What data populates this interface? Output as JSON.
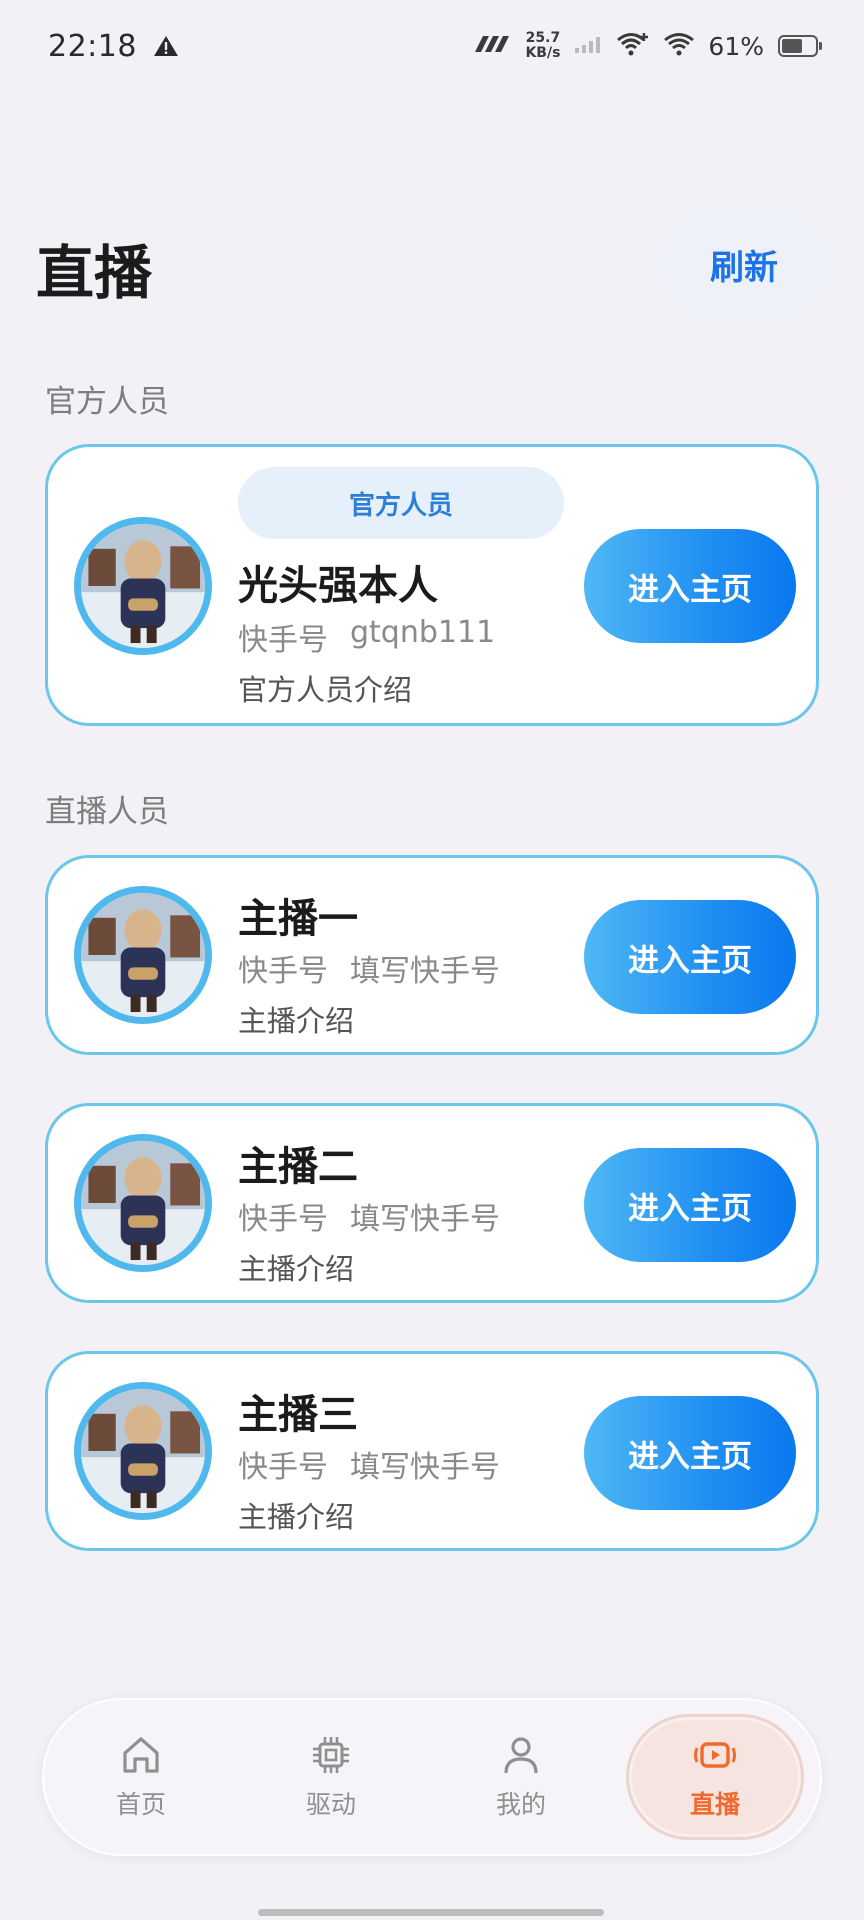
{
  "status_bar": {
    "time": "22:18",
    "net_speed_value": "25.7",
    "net_speed_unit": "KB/s",
    "battery_percent": "61%",
    "battery_level": 0.61,
    "icons": [
      "warning-icon",
      "hyperos-logo-icon",
      "signal-icon",
      "wifi-plus-icon",
      "wifi-icon",
      "battery-icon"
    ]
  },
  "header": {
    "title": "直播",
    "refresh_label": "刷新"
  },
  "official_section": {
    "label": "官方人员",
    "card": {
      "badge": "官方人员",
      "name": "光头强本人",
      "kuaishou_label": "快手号",
      "kuaishou_value": "gtqnb111",
      "intro": "官方人员介绍",
      "button_label": "进入主页"
    }
  },
  "streamer_section": {
    "label": "直播人员",
    "cards": [
      {
        "name": "主播一",
        "kuaishou_label": "快手号",
        "kuaishou_value": "填写快手号",
        "intro": "主播介绍",
        "button_label": "进入主页"
      },
      {
        "name": "主播二",
        "kuaishou_label": "快手号",
        "kuaishou_value": "填写快手号",
        "intro": "主播介绍",
        "button_label": "进入主页"
      },
      {
        "name": "主播三",
        "kuaishou_label": "快手号",
        "kuaishou_value": "填写快手号",
        "intro": "主播介绍",
        "button_label": "进入主页"
      }
    ]
  },
  "bottom_nav": {
    "items": [
      {
        "label": "首页",
        "icon": "home-icon",
        "active": false
      },
      {
        "label": "驱动",
        "icon": "chip-icon",
        "active": false
      },
      {
        "label": "我的",
        "icon": "person-icon",
        "active": false
      },
      {
        "label": "直播",
        "icon": "live-video-icon",
        "active": true
      }
    ]
  },
  "colors": {
    "accent_blue": "#1a73e8",
    "card_border": "#6bc6ec",
    "active_nav": "#ee6a2f",
    "background": "#f4f1f6"
  }
}
